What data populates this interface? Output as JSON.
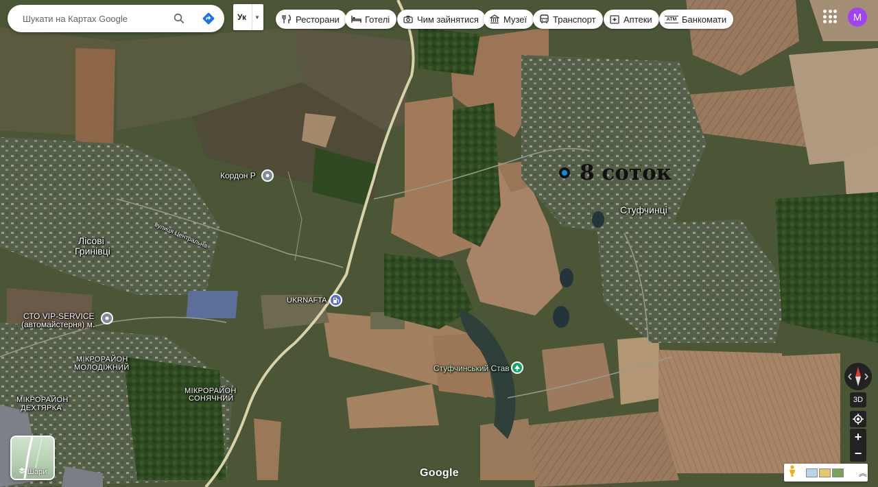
{
  "search": {
    "placeholder": "Шукати на Картах Google"
  },
  "input_tool": {
    "label": "Ук"
  },
  "chips": [
    {
      "icon": "fork-knife-icon",
      "label": "Ресторани"
    },
    {
      "icon": "bed-icon",
      "label": "Готелі"
    },
    {
      "icon": "camera-icon",
      "label": "Чим зайнятися"
    },
    {
      "icon": "museum-icon",
      "label": "Музеї"
    },
    {
      "icon": "bus-icon",
      "label": "Транспорт"
    },
    {
      "icon": "pharmacy-icon",
      "label": "Аптеки"
    },
    {
      "icon": "atm-icon",
      "label": "Банкомати"
    }
  ],
  "account": {
    "initial": "M",
    "color": "#a142f4"
  },
  "annotation": {
    "text": "8 соток"
  },
  "map_labels": {
    "kordon": "Кордон Р",
    "lisovi_1": "Лісові",
    "lisovi_2": "Гринівці",
    "street": "вулиця Центральна",
    "ukrnafta": "UKRNAFTA",
    "sto_1": "СТО VIP-SERVICE",
    "sto_2": "(автомайстерня) м.",
    "molod_1": "МІКРОРАЙОН",
    "molod_2": "МОЛОДІЖНИЙ",
    "sonyach_1": "МІКРОРАЙОН",
    "sonyach_2": "СОНЯЧНИЙ",
    "dekht_1": "МІКРОРАЙОН",
    "dekht_2": "ДЕХТЯРКА",
    "styufchyntsi": "Стуфчинці",
    "stav": "Стуфчинський Став"
  },
  "layers": {
    "label": "Шари"
  },
  "controls": {
    "three_d": "3D",
    "zoom_in": "+",
    "zoom_out": "−"
  },
  "logo": "Google",
  "colors": {
    "poi_gray": "#7f8c96",
    "gas_blue": "#5a6fd1",
    "park_green": "#12a36a",
    "brand_blue": "#1a73e8"
  }
}
